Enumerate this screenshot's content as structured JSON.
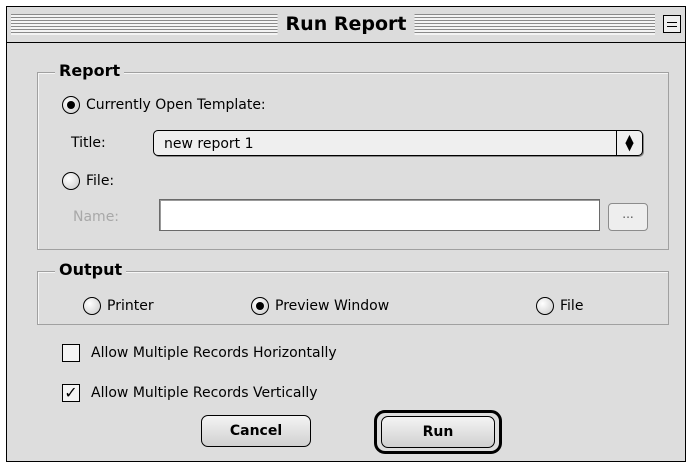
{
  "window": {
    "title": "Run Report"
  },
  "report": {
    "group_label": "Report",
    "template_option": "Currently Open Template:",
    "template_selected": true,
    "title_label": "Title:",
    "title_value": "new report 1",
    "file_option": "File:",
    "file_selected": false,
    "name_label": "Name:",
    "name_value": "",
    "browse_label": "..."
  },
  "output": {
    "group_label": "Output",
    "options": [
      {
        "label": "Printer",
        "selected": false
      },
      {
        "label": "Preview Window",
        "selected": true
      },
      {
        "label": "File",
        "selected": false
      }
    ]
  },
  "options": {
    "horizontal": {
      "label": "Allow Multiple Records Horizontally",
      "checked": false
    },
    "vertical": {
      "label": "Allow Multiple Records Vertically",
      "checked": true
    }
  },
  "buttons": {
    "cancel": "Cancel",
    "run": "Run"
  },
  "icons": {
    "collapse": "collapse-box-icon",
    "popup": "popup-arrows-icon",
    "check": "checkmark-icon"
  }
}
